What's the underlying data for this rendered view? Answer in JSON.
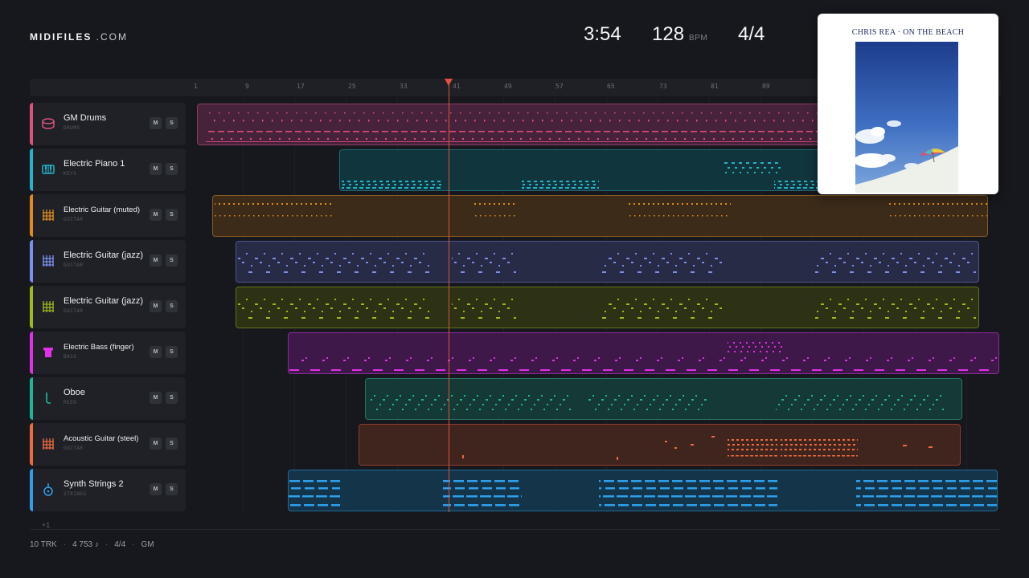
{
  "header": {
    "logo_main": "MIDIFILES",
    "logo_suffix": " .COM",
    "duration": "3:54",
    "tempo": "128",
    "tempo_unit": "BPM",
    "time_signature": "4/4"
  },
  "ruler": {
    "ticks": [
      "1",
      "9",
      "17",
      "25",
      "33",
      "41",
      "49",
      "57",
      "65",
      "73",
      "81",
      "89"
    ]
  },
  "tracks": [
    {
      "name": "GM Drums",
      "category": "DRUMS",
      "icon": "drum-icon",
      "color": "#e0507d"
    },
    {
      "name": "Electric Piano 1",
      "category": "KEYS",
      "icon": "piano-keys-icon",
      "color": "#22b4c8"
    },
    {
      "name": "Electric Guitar (muted)",
      "category": "GUITAR",
      "icon": "guitar-fretboard-icon",
      "color": "#e08a1e"
    },
    {
      "name": "Electric Guitar (jazz)",
      "category": "GUITAR",
      "icon": "guitar-fretboard-icon",
      "color": "#7a8ff0"
    },
    {
      "name": "Electric Guitar (jazz)",
      "category": "GUITAR",
      "icon": "guitar-fretboard-icon",
      "color": "#9cba1f"
    },
    {
      "name": "Electric Bass (finger)",
      "category": "BASS",
      "icon": "bass-icon",
      "color": "#e030e8"
    },
    {
      "name": "Oboe",
      "category": "REED",
      "icon": "reed-icon",
      "color": "#1fb59a"
    },
    {
      "name": "Acoustic Guitar (steel)",
      "category": "GUITAR",
      "icon": "guitar-fretboard-icon",
      "color": "#ee6a3d"
    },
    {
      "name": "Synth Strings 2",
      "category": "STRINGS",
      "icon": "strings-icon",
      "color": "#2ea0ea"
    }
  ],
  "track_buttons": {
    "mute": "M",
    "solo": "S"
  },
  "more_tracks": "+1",
  "footer": {
    "track_count": "10 TRK",
    "note_count": "4 753 ♪",
    "signature": "4/4",
    "standard": "GM"
  },
  "album": {
    "title": "CHRIS REA · ON THE BEACH"
  },
  "colors": {
    "background": "#17181d",
    "playhead": "#e2503f"
  }
}
